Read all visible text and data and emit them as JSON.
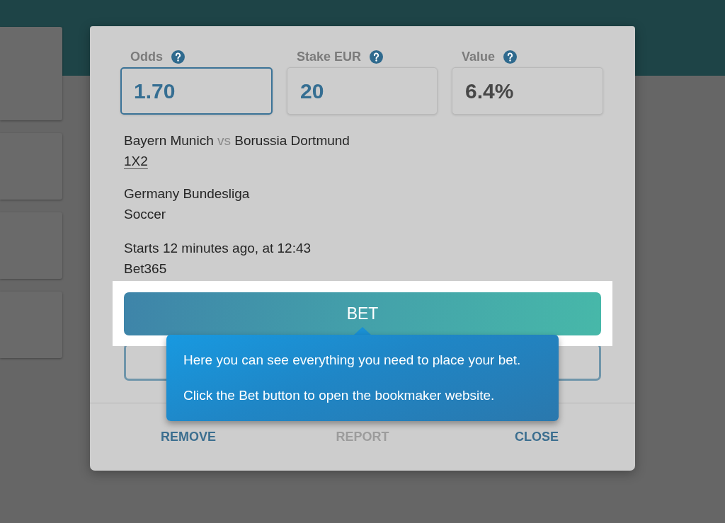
{
  "fields": [
    {
      "label": "Odds",
      "value": "1.70",
      "kind": "input",
      "focused": true
    },
    {
      "label": "Stake EUR",
      "value": "20",
      "kind": "input",
      "focused": false
    },
    {
      "label": "Value",
      "value": "6.4%",
      "kind": "readout",
      "focused": false
    }
  ],
  "event": {
    "home": "Bayern Munich",
    "separator": "vs",
    "away": "Borussia Dortmund",
    "market": "1X2"
  },
  "competition": {
    "league": "Germany Bundesliga",
    "sport": "Soccer"
  },
  "schedule": {
    "start": "Starts 12 minutes ago, at 12:43",
    "bookmaker": "Bet365"
  },
  "bet_button": {
    "label": "BET",
    "highlighted": true
  },
  "footer_buttons": [
    {
      "label": "REMOVE",
      "disabled": false
    },
    {
      "label": "REPORT",
      "disabled": true
    },
    {
      "label": "CLOSE",
      "disabled": false
    }
  ],
  "tour_tooltip": {
    "paragraphs": [
      "Here you can see everything you need to place your bet.",
      "Click the Bet button to open the bookmaker website."
    ]
  }
}
